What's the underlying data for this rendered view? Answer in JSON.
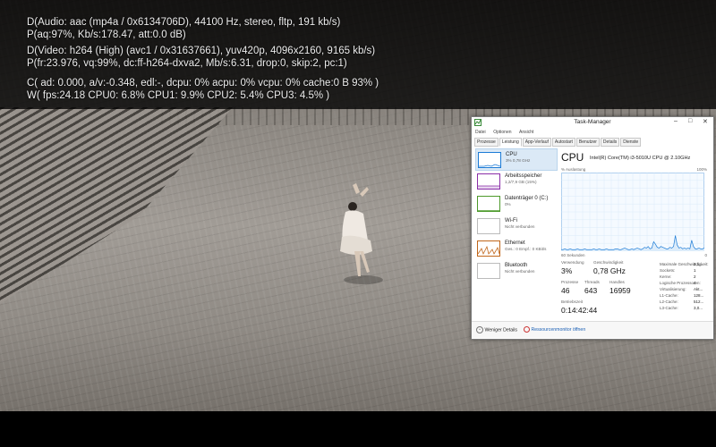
{
  "osd": {
    "lines": [
      "D(Audio: aac (mp4a / 0x6134706D), 44100 Hz, stereo, fltp, 191 kb/s)",
      "P(aq:97%, Kb/s:178.47, att:0.0 dB)",
      "D(Video: h264 (High) (avc1 / 0x31637661), yuv420p, 4096x2160, 9165 kb/s)",
      "P(fr:23.976, vq:99%, dc:ff-h264-dxva2, Mb/s:6.31, drop:0, skip:2, pc:1)",
      "C( ad: 0.000, a/v:-0.348, edl:-, dcpu: 0% acpu: 0% vcpu: 0% cache:0  B  93% )",
      "W( fps:24.18 CPU0: 6.8% CPU1: 9.9% CPU2: 5.4% CPU3: 4.5% )"
    ]
  },
  "taskmanager": {
    "title": "Task-Manager",
    "window_controls": [
      "–",
      "□",
      "✕"
    ],
    "menu": [
      "Datei",
      "Optionen",
      "Ansicht"
    ],
    "tabs": [
      "Prozesse",
      "Leistung",
      "App-Verlauf",
      "Autostart",
      "Benutzer",
      "Details",
      "Dienste"
    ],
    "active_tab": "Leistung",
    "sidebar": [
      {
        "name": "CPU",
        "sub": "3% 0,78 GHz",
        "color": "#1c7bd6"
      },
      {
        "name": "Arbeitsspeicher",
        "sub": "1,2/7,9 GB (15%)",
        "color": "#8a2ea8"
      },
      {
        "name": "Datenträger 0 (C:)",
        "sub": "0%",
        "color": "#4d9a2b"
      },
      {
        "name": "Wi-Fi",
        "sub": "Nicht verbunden",
        "color": "#a0a0a0"
      },
      {
        "name": "Ethernet",
        "sub": "Ges.: 0 Empf.: 0 KBit/s",
        "color": "#c0661a"
      },
      {
        "name": "Bluetooth",
        "sub": "Nicht verbunden",
        "color": "#a0a0a0"
      }
    ],
    "cpu": {
      "heading": "CPU",
      "model": "Intel(R) Core(TM) i3-5010U CPU @ 2.10GHz",
      "graph_label": "% Auslastung",
      "graph_max": "100%",
      "time_left": "60 Sekunden",
      "time_right": "0",
      "graph_color": "#1c7bd6",
      "graph_values": [
        2,
        2,
        3,
        2,
        2,
        3,
        2,
        2,
        2,
        3,
        2,
        2,
        2,
        3,
        2,
        2,
        2,
        2,
        3,
        2,
        2,
        3,
        2,
        2,
        2,
        3,
        2,
        2,
        2,
        2,
        3,
        3,
        2,
        2,
        3,
        4,
        3,
        2,
        2,
        3,
        2,
        3,
        4,
        3,
        2,
        3,
        5,
        4,
        6,
        3,
        4,
        12,
        9,
        5,
        4,
        6,
        5,
        4,
        3,
        3,
        5,
        4,
        6,
        20,
        8,
        4,
        5,
        3,
        4,
        3,
        4,
        3,
        14,
        6,
        3,
        3,
        4,
        3,
        3,
        4
      ]
    },
    "stats": {
      "usage_label": "Verwendung",
      "usage": "3%",
      "speed_label": "Geschwindigkeit",
      "speed": "0,78 GHz",
      "proc_label": "Prozesse",
      "proc": "46",
      "threads_label": "Threads",
      "threads": "643",
      "handles_label": "Handles",
      "handles": "16959",
      "uptime_label": "Betriebszeit",
      "uptime": "0:14:42:44"
    },
    "specs": [
      {
        "key": "Maximale Geschwindigkeit:",
        "value": "2,1..."
      },
      {
        "key": "Sockets:",
        "value": "1"
      },
      {
        "key": "Kerne:",
        "value": "2"
      },
      {
        "key": "Logische Prozessoren:",
        "value": "4"
      },
      {
        "key": "Virtualisierung:",
        "value": "Akt..."
      },
      {
        "key": "L1-Cache:",
        "value": "128..."
      },
      {
        "key": "L2-Cache:",
        "value": "512..."
      },
      {
        "key": "L3-Cache:",
        "value": "3,0..."
      }
    ],
    "footer": {
      "fewer_details": "Weniger Details",
      "resource_monitor": "Ressourcenmonitor öffnen"
    }
  }
}
